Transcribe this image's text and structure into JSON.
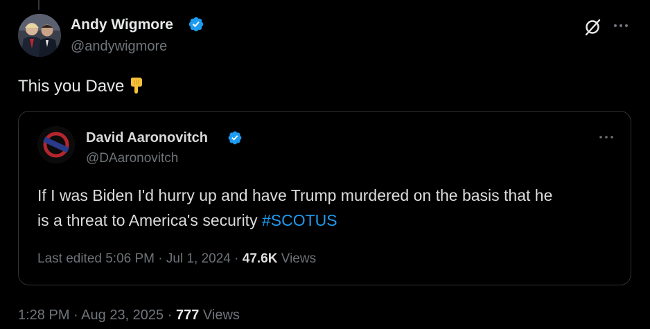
{
  "post": {
    "author_name": "Andy Wigmore",
    "author_handle": "@andywigmore",
    "text": "This you Dave",
    "emoji": "backhand-index-pointing-down",
    "time": "1:28 PM",
    "separator": "·",
    "date": "Aug 23, 2025",
    "views_count": "777",
    "views_label": "Views"
  },
  "quote": {
    "author_name": "David Aaronovitch",
    "author_handle": "@DAaronovitch",
    "text_line1": "If I was Biden I'd hurry up and have Trump murdered on the basis that he",
    "text_line2": "is a threat to America's security",
    "hashtag": "#SCOTUS",
    "edited_label": "Last edited 5:06 PM",
    "separator": "·",
    "date": "Jul 1, 2024",
    "views_count": "47.6K",
    "views_label": "Views"
  },
  "icons": {
    "verified": "verified-badge-icon",
    "grok": "grok-icon",
    "more": "more-options-icon"
  },
  "colors": {
    "background": "#000000",
    "verified_blue": "#1d9bf0",
    "hashtag": "#1d9bf0",
    "text_primary": "#e7e9ea",
    "text_secondary": "#71767b",
    "border": "#2f3336"
  }
}
